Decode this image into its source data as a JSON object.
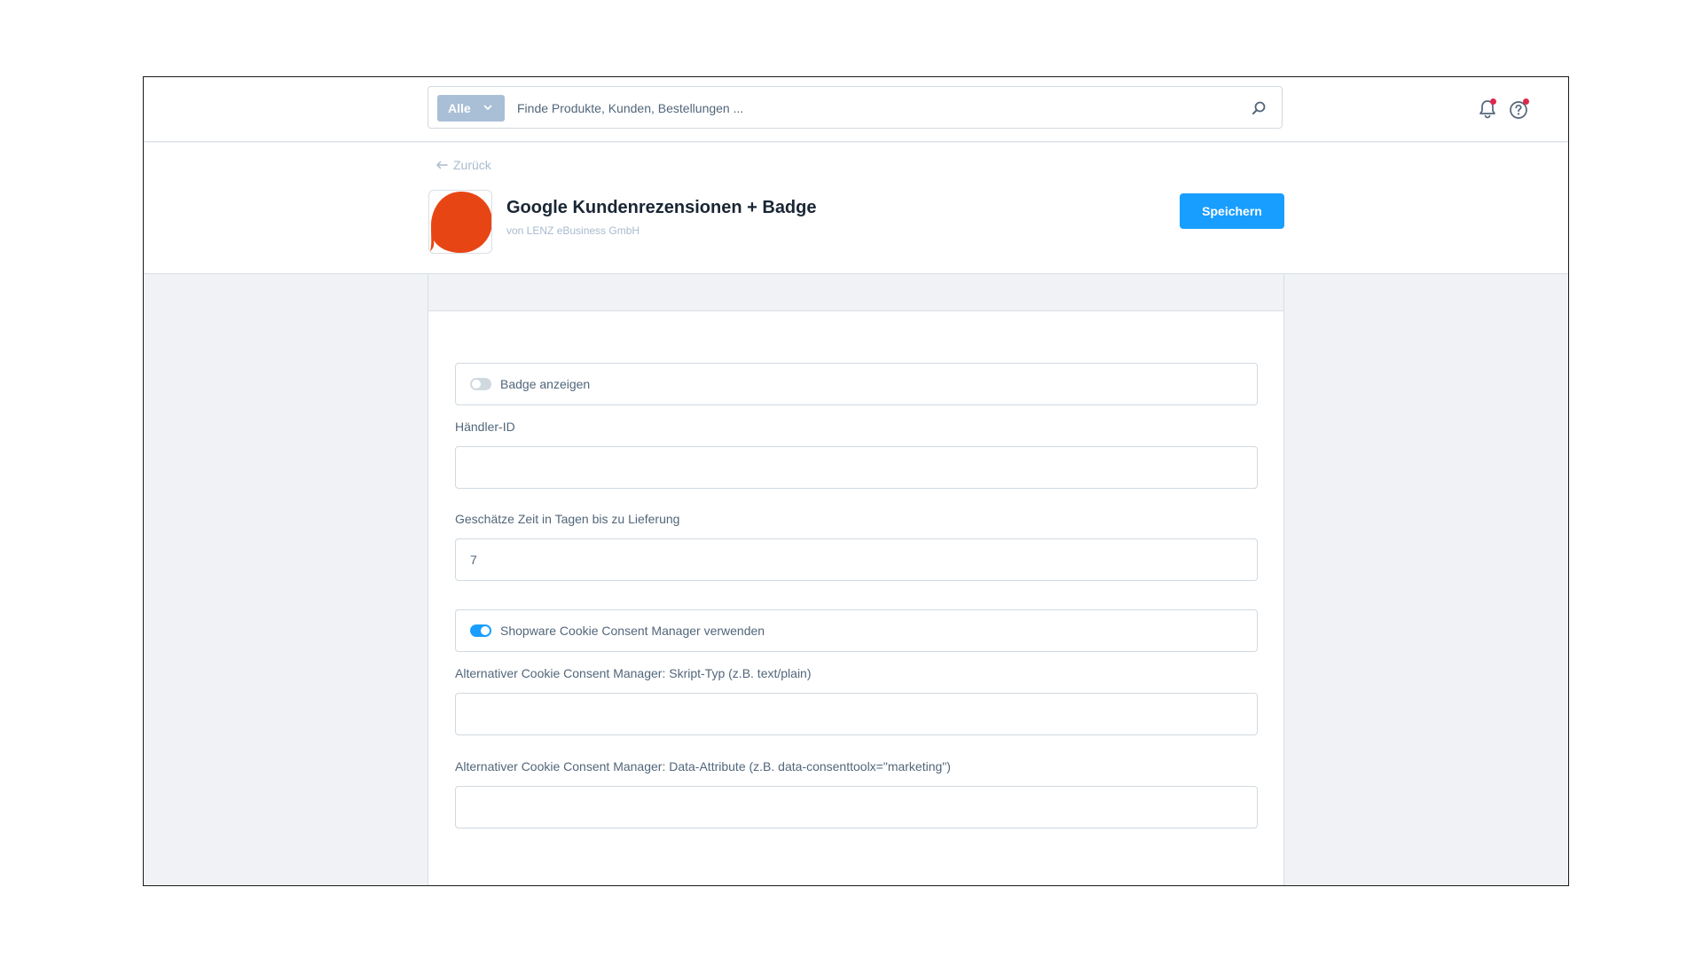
{
  "search": {
    "type_label": "Alle",
    "placeholder": "Finde Produkte, Kunden, Bestellungen ..."
  },
  "header": {
    "back_label": "Zurück",
    "app_title": "Google Kundenrezensionen + Badge",
    "app_vendor": "von LENZ eBusiness GmbH",
    "save_label": "Speichern"
  },
  "form": {
    "badge_toggle": {
      "label": "Badge anzeigen",
      "checked": false
    },
    "merchant_id": {
      "label": "Händler-ID",
      "value": ""
    },
    "delivery_days": {
      "label": "Geschätze Zeit in Tagen bis zu Lieferung",
      "value": "7"
    },
    "cookie_toggle": {
      "label": "Shopware Cookie Consent Manager verwenden",
      "checked": true
    },
    "script_type": {
      "label": "Alternativer Cookie Consent Manager: Skript-Typ (z.B. text/plain)",
      "value": ""
    },
    "data_attribute": {
      "label": "Alternativer Cookie Consent Manager: Data-Attribute (z.B. data-consenttoolx=\"marketing\")",
      "value": ""
    }
  },
  "colors": {
    "primary": "#189eff",
    "logo": "#e84515",
    "notification_dot": "#de294c"
  },
  "icons": [
    "chevron-down-icon",
    "search-icon",
    "bell-icon",
    "help-icon",
    "arrow-left-icon",
    "speech-bubble-logo"
  ]
}
